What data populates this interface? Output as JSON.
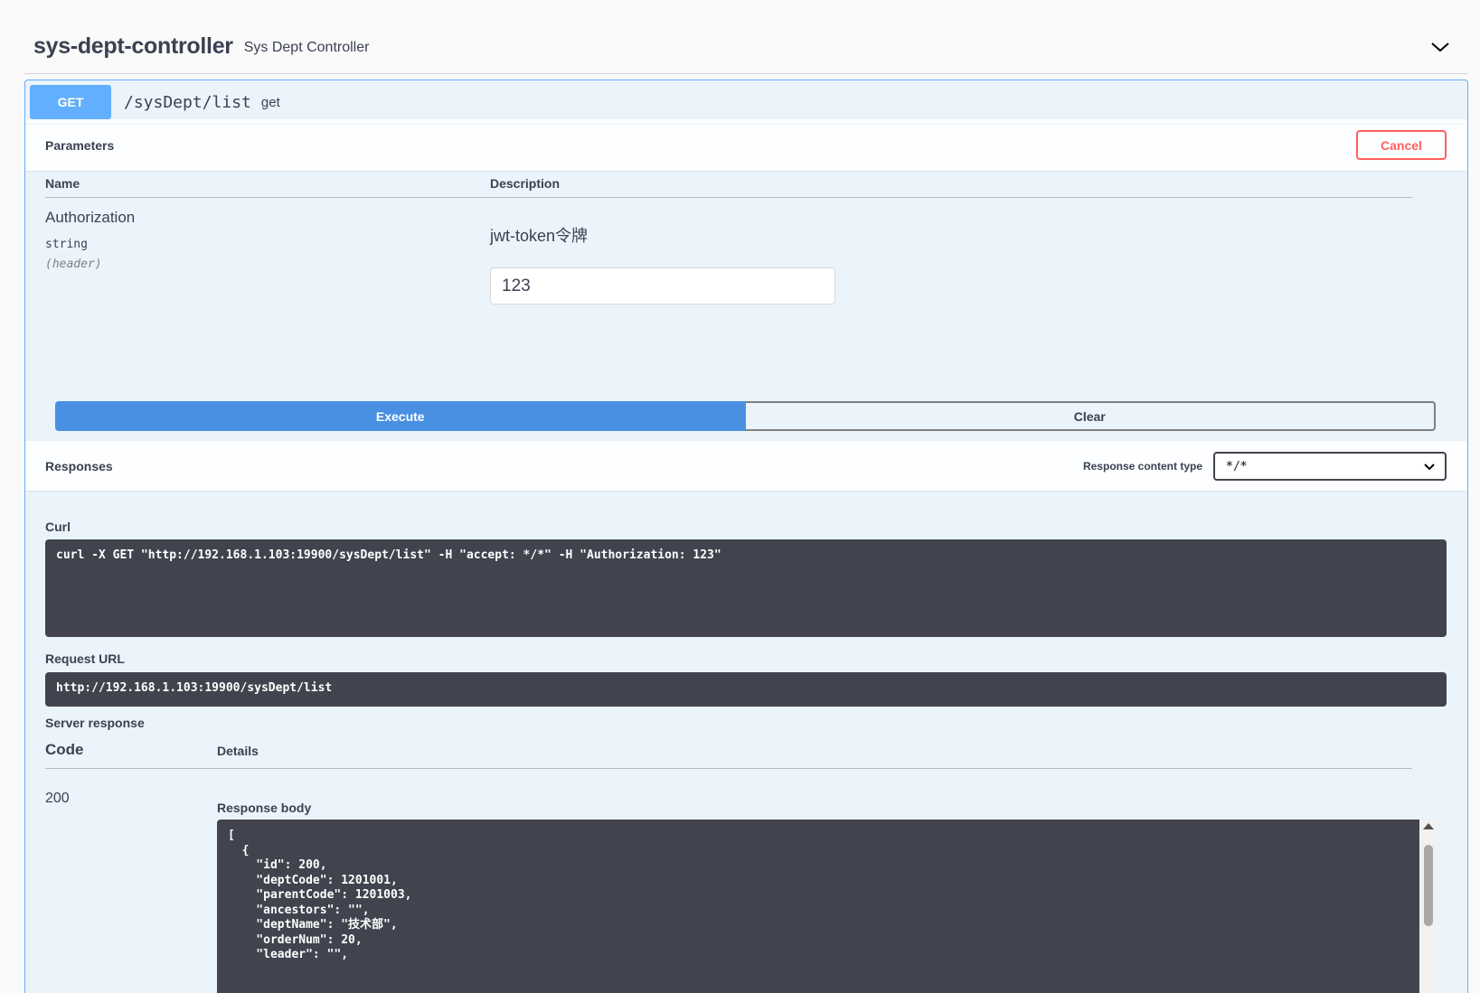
{
  "tag": {
    "name": "sys-dept-controller",
    "description": "Sys Dept Controller"
  },
  "operation": {
    "method": "GET",
    "path": "/sysDept/list",
    "summary": "get"
  },
  "parameters": {
    "title": "Parameters",
    "cancel_label": "Cancel",
    "col_name": "Name",
    "col_description": "Description",
    "items": [
      {
        "name": "Authorization",
        "type": "string",
        "in": "(header)",
        "description": "jwt-token令牌",
        "value": "123"
      }
    ]
  },
  "actions": {
    "execute_label": "Execute",
    "clear_label": "Clear"
  },
  "responses": {
    "title": "Responses",
    "content_type_label": "Response content type",
    "content_type_value": "*/*"
  },
  "curl": {
    "label": "Curl",
    "command": "curl -X GET \"http://192.168.1.103:19900/sysDept/list\" -H \"accept: */*\" -H \"Authorization: 123\""
  },
  "request_url": {
    "label": "Request URL",
    "value": "http://192.168.1.103:19900/sysDept/list"
  },
  "server_response": {
    "label": "Server response",
    "col_code": "Code",
    "col_details": "Details",
    "code": "200",
    "body_label": "Response body",
    "body": "[\n  {\n    \"id\": 200,\n    \"deptCode\": 1201001,\n    \"parentCode\": 1201003,\n    \"ancestors\": \"\",\n    \"deptName\": \"技术部\",\n    \"orderNum\": 20,\n    \"leader\": \"\","
  },
  "colors": {
    "get": "#61affe",
    "execute": "#4990e2",
    "cancel": "#ff6060",
    "code_bg": "#41444e"
  }
}
